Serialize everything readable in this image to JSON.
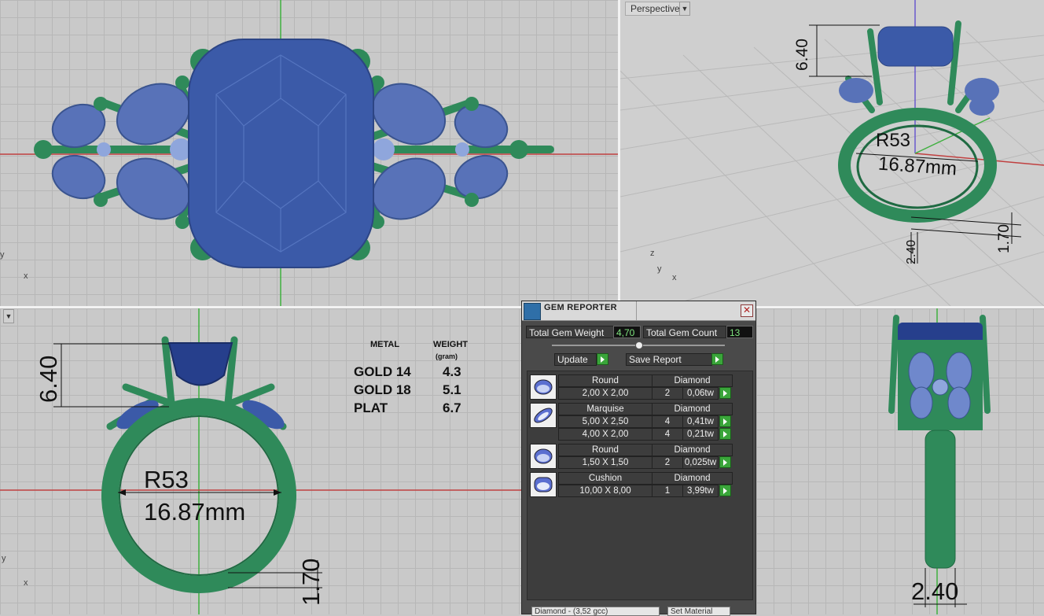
{
  "viewports": {
    "perspective_label": "Perspective"
  },
  "axes": {
    "x": "x",
    "y": "y",
    "z": "z"
  },
  "dimensions": {
    "prong_height": "6.40",
    "ring_size": "R53",
    "inner_diameter": "16.87mm",
    "band_thickness": "1.70",
    "band_width_persp": "2.40",
    "band_width_right": "2.40"
  },
  "weight_table": {
    "metal_header": "METAL",
    "weight_header": "WEIGHT",
    "weight_unit": "(gram)",
    "rows": [
      {
        "metal": "GOLD  14",
        "weight": "4.3"
      },
      {
        "metal": "GOLD  18",
        "weight": "5.1"
      },
      {
        "metal": "PLAT",
        "weight": "6.7"
      }
    ]
  },
  "gem_reporter": {
    "title": "GEM REPORTER",
    "total_weight_label": "Total Gem Weight",
    "total_weight_value": "4,70",
    "total_count_label": "Total Gem Count",
    "total_count_value": "13",
    "update_label": "Update",
    "save_report_label": "Save Report",
    "gems": [
      {
        "cut": "Round",
        "material": "Diamond",
        "icon": "round-gem-icon",
        "sizes": [
          {
            "size": "2,00 X 2,00",
            "count": "2",
            "weight": "0,06tw"
          }
        ]
      },
      {
        "cut": "Marquise",
        "material": "Diamond",
        "icon": "marquise-gem-icon",
        "sizes": [
          {
            "size": "5,00 X 2,50",
            "count": "4",
            "weight": "0,41tw"
          },
          {
            "size": "4,00 X 2,00",
            "count": "4",
            "weight": "0,21tw"
          }
        ]
      },
      {
        "cut": "Round",
        "material": "Diamond",
        "icon": "round-gem-icon",
        "sizes": [
          {
            "size": "1,50 X 1,50",
            "count": "2",
            "weight": "0,025tw"
          }
        ]
      },
      {
        "cut": "Cushion",
        "material": "Diamond",
        "icon": "cushion-gem-icon",
        "sizes": [
          {
            "size": "10,00 X 8,00",
            "count": "1",
            "weight": "3,99tw"
          }
        ]
      }
    ],
    "bottom_select": "Diamond - (3,52 gcc)",
    "bottom_button": "Set Material"
  },
  "colors": {
    "metal": "#2f8a5a",
    "metal_dark": "#1f6a42",
    "gem": "#3b5aa8",
    "gem_light": "#8fa6dc",
    "viewport_bg": "#c9c9c9",
    "panel_bg": "#4a4a4a",
    "value_text": "#7ee37e",
    "button_green": "#3aa53a"
  }
}
